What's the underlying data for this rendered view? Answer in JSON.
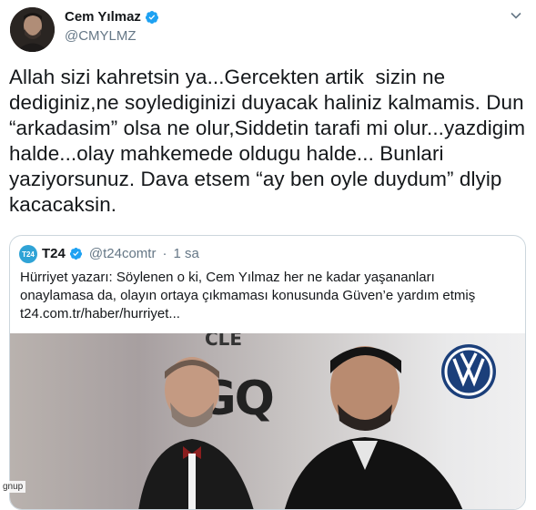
{
  "author": {
    "name": "Cem Yılmaz",
    "handle": "@CMYLMZ",
    "verified_icon": "verified-badge-icon",
    "more_icon": "chevron-down-icon"
  },
  "tweet": {
    "text": "Allah sizi kahretsin ya...Gercekten artik  sizin ne dediginiz,ne soylediginizi duyacak haliniz kalmamis. Dun “arkadasim” olsa ne olur,Siddetin tarafi mi olur...yazdigim halde...olay mahkemede oldugu halde... Bunlari yaziyorsunuz. Dava etsem “ay ben oyle duydum” dlyip kacacaksin."
  },
  "quoted": {
    "avatar_text": "T24",
    "name": "T24",
    "handle": "@t24comtr",
    "separator": "·",
    "time": "1 sa",
    "text": "Hürriyet yazarı: Söylenen o ki, Cem Yılmaz her ne kadar yaşananları onaylamasa da, olayın ortaya çıkmaması konusunda Güven’e yardım etmiş t24.com.tr/haber/hurriyet...",
    "image_signs": {
      "top": "CLE",
      "main": "GQ"
    }
  },
  "overlay": {
    "text": "gnup"
  },
  "colors": {
    "accent": "#1da1f2",
    "text": "#14171a",
    "muted": "#657786",
    "border": "#ccd6dd"
  }
}
